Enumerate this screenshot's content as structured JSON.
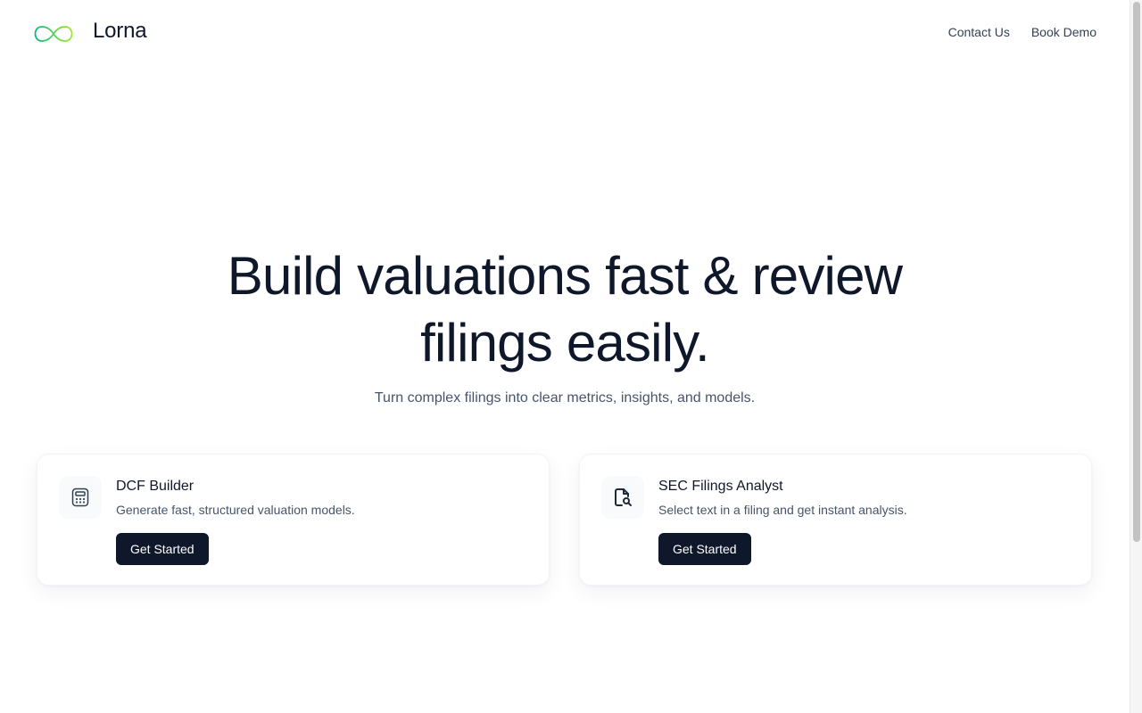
{
  "header": {
    "brand": "Lorna",
    "logo_icon": "infinity-icon",
    "nav": [
      {
        "label": "Contact Us"
      },
      {
        "label": "Book Demo"
      }
    ]
  },
  "hero": {
    "title_line1": "Build valuations fast & review",
    "title_line2": "filings easily.",
    "subtitle": "Turn complex filings into clear metrics, insights, and models."
  },
  "cards": [
    {
      "icon": "calculator-icon",
      "title": "DCF Builder",
      "description": "Generate fast, structured valuation models.",
      "button": "Get Started"
    },
    {
      "icon": "file-search-icon",
      "title": "SEC Filings Analyst",
      "description": "Select text in a filing and get instant analysis.",
      "button": "Get Started"
    }
  ],
  "colors": {
    "primary": "#0f172a",
    "muted_text": "#475569",
    "logo_gradient_start": "#10b981",
    "logo_gradient_end": "#a3e635"
  }
}
